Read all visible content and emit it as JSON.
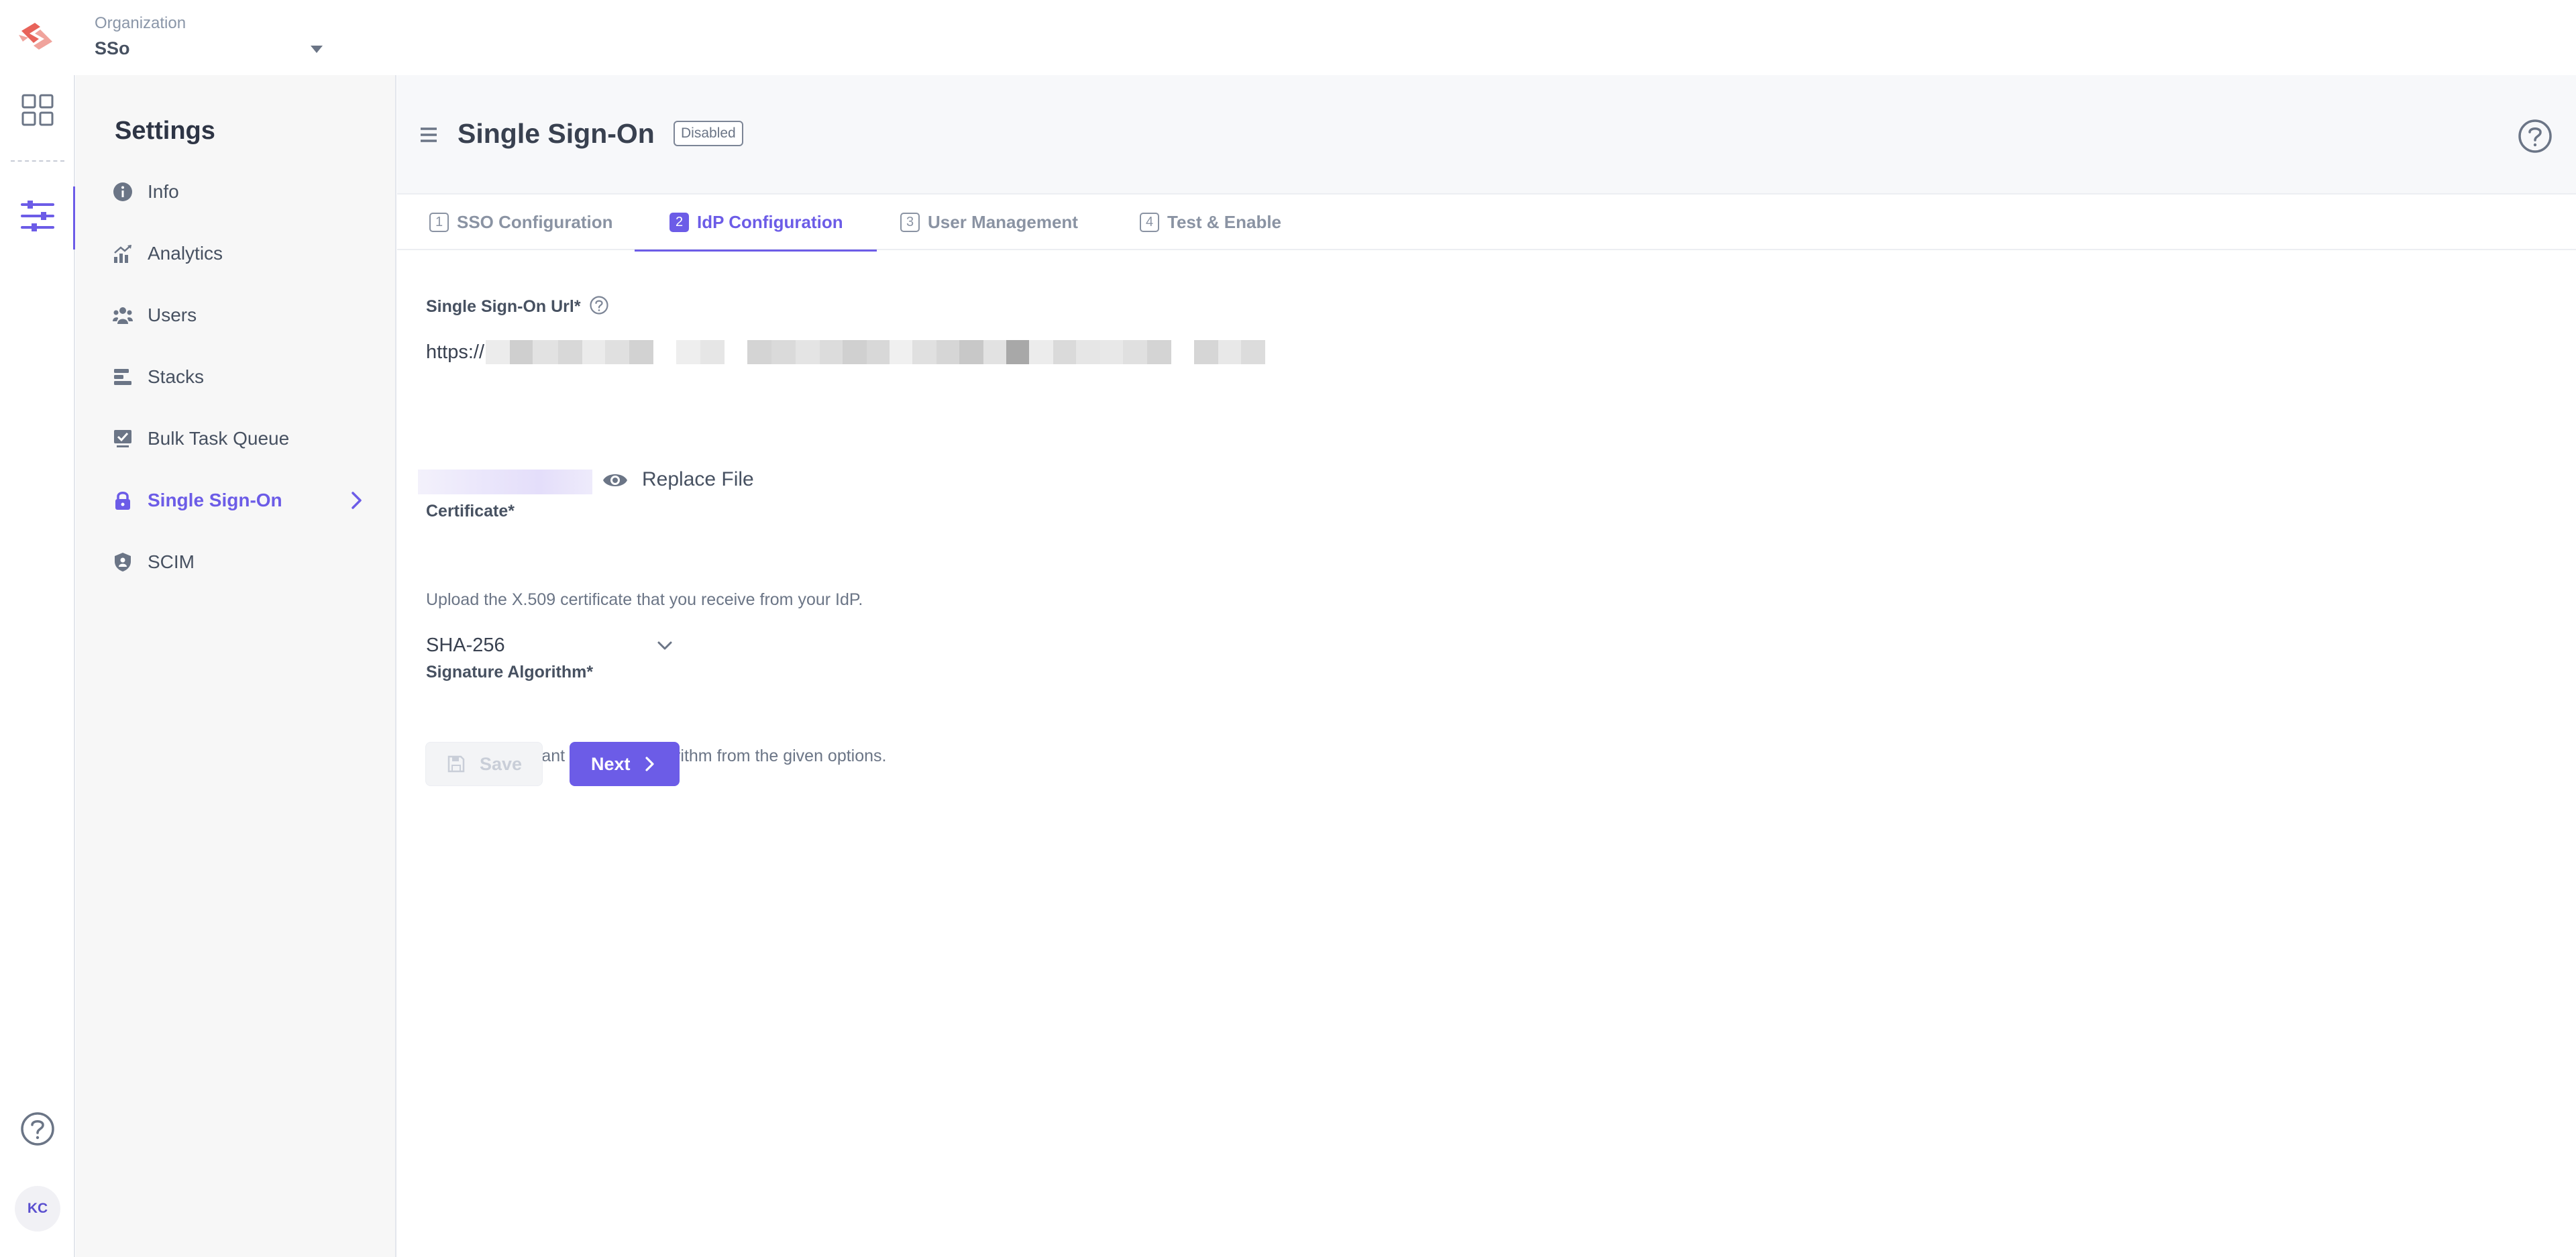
{
  "topbar": {
    "org_label": "Organization",
    "org_value": "SSo"
  },
  "rail": {
    "items": [
      {
        "icon": "grid-icon",
        "active": false
      },
      {
        "icon": "sliders-icon",
        "active": true
      }
    ],
    "help_icon": "question-circle-icon",
    "avatar_initials": "KC"
  },
  "settings": {
    "title": "Settings",
    "items": [
      {
        "label": "Info",
        "icon": "info-icon",
        "active": false
      },
      {
        "label": "Analytics",
        "icon": "analytics-icon",
        "active": false
      },
      {
        "label": "Users",
        "icon": "users-icon",
        "active": false
      },
      {
        "label": "Stacks",
        "icon": "stacks-icon",
        "active": false
      },
      {
        "label": "Bulk Task Queue",
        "icon": "task-queue-icon",
        "active": false
      },
      {
        "label": "Single Sign-On",
        "icon": "lock-icon",
        "active": true
      },
      {
        "label": "SCIM",
        "icon": "shield-user-icon",
        "active": false
      }
    ]
  },
  "header": {
    "title": "Single Sign-On",
    "status": "Disabled"
  },
  "tabs": [
    {
      "number": "1",
      "label": "SSO Configuration",
      "active": false
    },
    {
      "number": "2",
      "label": "IdP Configuration",
      "active": true
    },
    {
      "number": "3",
      "label": "User Management",
      "active": false
    },
    {
      "number": "4",
      "label": "Test & Enable",
      "active": false
    }
  ],
  "form": {
    "sso_url": {
      "label": "Single Sign-On Url*",
      "value_prefix": "https://"
    },
    "certificate": {
      "label": "Certificate*",
      "replace_label": "Replace File",
      "hint": "Upload the X.509 certificate that you receive from your IdP."
    },
    "signature_algorithm": {
      "label": "Signature Algorithm*",
      "value": "SHA-256",
      "hint": "Select the relevant signature algorithm from the given options."
    }
  },
  "actions": {
    "save_label": "Save",
    "save_disabled": true,
    "next_label": "Next"
  },
  "colors": {
    "accent": "#6c5ce7",
    "text": "#475161",
    "muted": "#8a93a3",
    "sidebar_bg": "#f7f7f7",
    "header_bg": "#f7f8fa",
    "logo": "#e8635a"
  }
}
